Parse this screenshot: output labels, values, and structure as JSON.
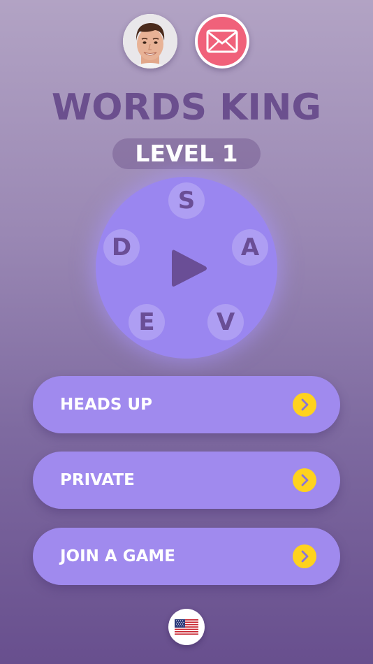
{
  "header": {
    "profile_icon": "user-avatar",
    "mail_icon": "envelope-icon"
  },
  "app_title": "WORDS KING",
  "level_label": "LEVEL 1",
  "wheel": {
    "letters": [
      "S",
      "A",
      "V",
      "E",
      "D"
    ],
    "center_icon": "play-icon"
  },
  "menu": [
    {
      "label": "HEADS UP",
      "icon": "chevron-right-icon"
    },
    {
      "label": "PRIVATE",
      "icon": "chevron-right-icon"
    },
    {
      "label": "JOIN A GAME",
      "icon": "chevron-right-icon"
    }
  ],
  "language_icon": "us-flag-icon",
  "colors": {
    "accent": "#a08aee",
    "wheel": "#9a86f0",
    "mail": "#f0617a",
    "chevron": "#ffd21e",
    "title": "#6b4f8e"
  }
}
